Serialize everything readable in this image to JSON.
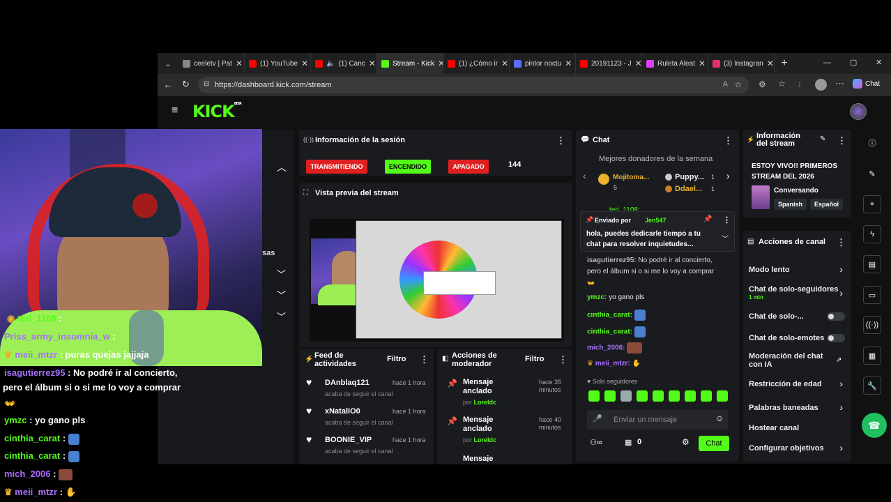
{
  "browser": {
    "tabs": [
      {
        "label": "ceeletv | Pat",
        "icon_color": "#888888"
      },
      {
        "label": "(1) YouTube",
        "icon_color": "#ff0000"
      },
      {
        "label": "(1) Canc",
        "icon_color": "#ff0000"
      },
      {
        "label": "Stream - Kick",
        "icon_color": "#53fc18"
      },
      {
        "label": "(1) ¿Cómo ir",
        "icon_color": "#ff0000"
      },
      {
        "label": "pintor noctu",
        "icon_color": "#5b6cff"
      },
      {
        "label": "20191123 - J",
        "icon_color": "#ff0000"
      },
      {
        "label": "Ruleta Aleat",
        "icon_color": "#e040fb"
      },
      {
        "label": "(3) Instagran",
        "icon_color": "#e1306c"
      }
    ],
    "url": "https://dashboard.kick.com/stream",
    "chat_button": "Chat",
    "window_controls": [
      "—",
      "▢",
      "✕"
    ]
  },
  "kick": {
    "logo": "KICK",
    "logo_sup": "BETA",
    "session": {
      "title": "Información de la sesión",
      "badges": [
        "TRANSMITIENDO",
        "ENCENDIDO",
        "APAGADO"
      ],
      "viewers": "144"
    },
    "preview": {
      "title": "Vista previa del stream"
    },
    "activity": {
      "title": "Feed de actividades",
      "filter": "Filtro",
      "items": [
        {
          "user": "DAnblaq121",
          "text": "acaba de seguir el canal",
          "time": "hace 1 hora"
        },
        {
          "user": "xNataliO0",
          "text": "acaba de seguir el canal",
          "time": "hace 1 hora"
        },
        {
          "user": "BOONIE_VIP",
          "text": "acaba de seguir el canal",
          "time": "hace 1 hora"
        }
      ]
    },
    "modactions": {
      "title": "Acciones de moderador",
      "filter": "Filtro",
      "items": [
        {
          "action": "Mensaje anclado",
          "by_label": "por",
          "by": "Loreldc",
          "time": "hace 35 minutos"
        },
        {
          "action": "Mensaje anclado",
          "by_label": "por",
          "by": "Loreldc",
          "time": "hace 40 minutos"
        }
      ],
      "partial": "Mensaje"
    },
    "chat": {
      "title": "Chat",
      "donors_title": "Mejores donadores de la semana",
      "donors": [
        {
          "name": "Mojitoma...",
          "count": "5"
        },
        {
          "name": "Puppy...",
          "count": "1"
        },
        {
          "name": "Ddael...",
          "count": "1"
        }
      ],
      "partial_user": "teri_1108:",
      "pinned": {
        "label": "Enviado por",
        "user": "Jen547",
        "text": "hola, puedes dedicarle tiempo a tu chat para resolver inquietudes..."
      },
      "messages": [
        {
          "user": "isagutierrez95:",
          "text": "No podré ir al concierto, pero el álbum si o si me lo voy a comprar",
          "color": "#b7b7b7"
        },
        {
          "user": "ymzc:",
          "text": "yo gano pls",
          "color": "#53fc18"
        },
        {
          "user": "cinthia_carat:",
          "text": "",
          "color": "#53fc18"
        },
        {
          "user": "cinthia_carat:",
          "text": "",
          "color": "#53fc18"
        },
        {
          "user": "mich_2006:",
          "text": "",
          "color": "#a970ff"
        },
        {
          "user": "meii_mtzr:",
          "text": "",
          "color": "#a970ff"
        }
      ],
      "followers_only": "Solo seguidores",
      "placeholder": "Enviar un mensaje",
      "count_zero": "0",
      "send": "Chat"
    },
    "streaminfo": {
      "title": "Información del stream",
      "stream_title": "ESTOY VIVO!! PRIMEROS STREAM DEL 2026",
      "category": "Conversando",
      "tags": [
        "Spanish",
        "Español"
      ]
    },
    "channel_actions": {
      "title": "Acciones de canal",
      "items": [
        {
          "label": "Modo lento",
          "sub": ""
        },
        {
          "label": "Chat de solo-seguidores",
          "sub": "1 min"
        },
        {
          "label": "Chat de solo-...",
          "sub": ""
        },
        {
          "label": "Chat de solo-emotes",
          "sub": ""
        },
        {
          "label": "Moderación del chat con IA",
          "sub": ""
        },
        {
          "label": "Restricción de edad",
          "sub": ""
        },
        {
          "label": "Palabras baneadas",
          "sub": ""
        },
        {
          "label": "Hostear canal",
          "sub": ""
        },
        {
          "label": "Configurar objetivos",
          "sub": ""
        }
      ]
    },
    "left_partial": "sas"
  },
  "overlay_chat": [
    {
      "user": "teri_1108",
      "text": ":",
      "color": "#53fc18"
    },
    {
      "user": "Priss_army_insomnia_w",
      "text": ":",
      "color": "#a970ff"
    },
    {
      "user": "meii_mtzr",
      "text": ": puras quejas jajjaja",
      "color": "#a970ff"
    },
    {
      "user": "isagutierrez95",
      "text": ": No podré ir al concierto,",
      "color": "#a970ff"
    },
    {
      "user": "",
      "text": "pero el álbum si o si me lo voy a comprar",
      "color": "#ffffff"
    },
    {
      "user": "ymzc",
      "text": ": yo gano pls",
      "color": "#53fc18"
    },
    {
      "user": "cinthia_carat",
      "text": ":",
      "color": "#53fc18"
    },
    {
      "user": "cinthia_carat",
      "text": ":",
      "color": "#53fc18"
    },
    {
      "user": "mich_2006",
      "text": ":",
      "color": "#a970ff"
    },
    {
      "user": "meii_mtzr",
      "text": ":",
      "color": "#a970ff"
    }
  ],
  "colors": {
    "kick_green": "#53fc18",
    "live_red": "#e02020",
    "panel": "#191b1f"
  }
}
